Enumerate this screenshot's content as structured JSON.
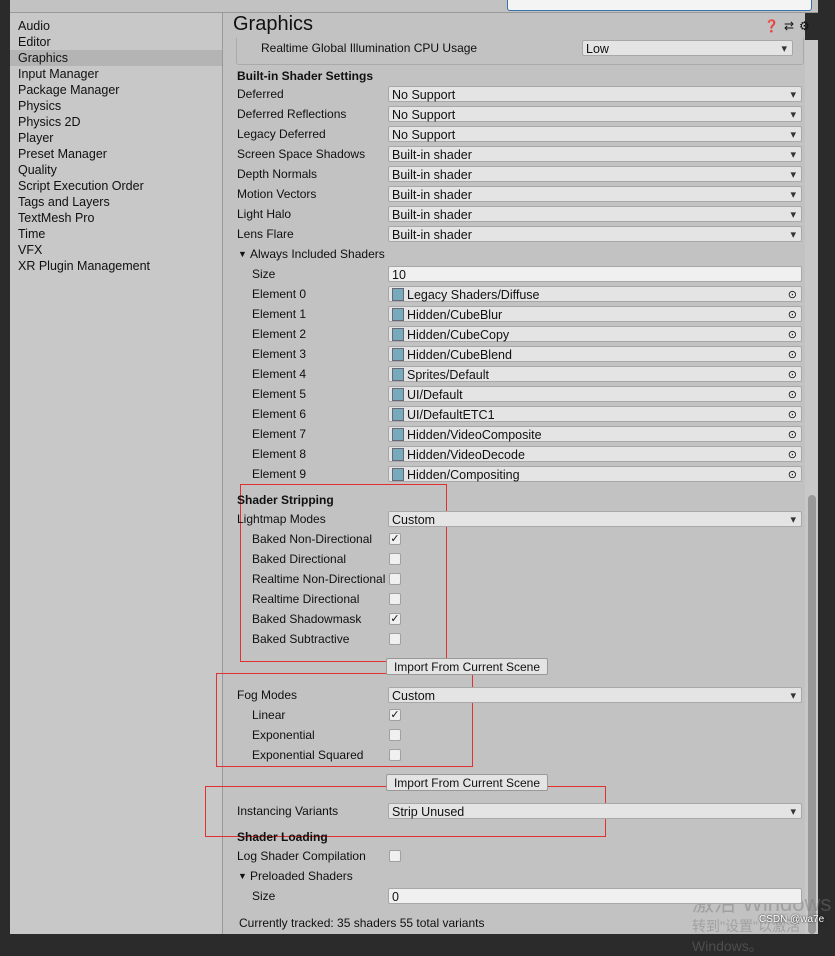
{
  "sidebar": {
    "items": [
      "Audio",
      "Editor",
      "Graphics",
      "Input Manager",
      "Package Manager",
      "Physics",
      "Physics 2D",
      "Player",
      "Preset Manager",
      "Quality",
      "Script Execution Order",
      "Tags and Layers",
      "TextMesh Pro",
      "Time",
      "VFX",
      "XR Plugin Management"
    ],
    "selected": "Graphics"
  },
  "header": {
    "title": "Graphics",
    "icons": [
      "help-icon",
      "preset-icon",
      "gear-icon"
    ]
  },
  "gi": {
    "label": "Realtime Global Illumination CPU Usage",
    "value": "Low"
  },
  "builtin": {
    "heading": "Built-in Shader Settings",
    "rows": [
      {
        "label": "Deferred",
        "value": "No Support"
      },
      {
        "label": "Deferred Reflections",
        "value": "No Support"
      },
      {
        "label": "Legacy Deferred",
        "value": "No Support"
      },
      {
        "label": "Screen Space Shadows",
        "value": "Built-in shader"
      },
      {
        "label": "Depth Normals",
        "value": "Built-in shader"
      },
      {
        "label": "Motion Vectors",
        "value": "Built-in shader"
      },
      {
        "label": "Light Halo",
        "value": "Built-in shader"
      },
      {
        "label": "Lens Flare",
        "value": "Built-in shader"
      }
    ]
  },
  "always": {
    "label": "Always Included Shaders",
    "size_label": "Size",
    "size": "10",
    "elements": [
      {
        "label": "Element 0",
        "value": "Legacy Shaders/Diffuse"
      },
      {
        "label": "Element 1",
        "value": "Hidden/CubeBlur"
      },
      {
        "label": "Element 2",
        "value": "Hidden/CubeCopy"
      },
      {
        "label": "Element 3",
        "value": "Hidden/CubeBlend"
      },
      {
        "label": "Element 4",
        "value": "Sprites/Default"
      },
      {
        "label": "Element 5",
        "value": "UI/Default"
      },
      {
        "label": "Element 6",
        "value": "UI/DefaultETC1"
      },
      {
        "label": "Element 7",
        "value": "Hidden/VideoComposite"
      },
      {
        "label": "Element 8",
        "value": "Hidden/VideoDecode"
      },
      {
        "label": "Element 9",
        "value": "Hidden/Compositing"
      }
    ]
  },
  "stripping": {
    "heading": "Shader Stripping",
    "lightmap_label": "Lightmap Modes",
    "lightmap_value": "Custom",
    "lightmap_options": [
      {
        "label": "Baked Non-Directional",
        "checked": true
      },
      {
        "label": "Baked Directional",
        "checked": false
      },
      {
        "label": "Realtime Non-Directional",
        "checked": false
      },
      {
        "label": "Realtime Directional",
        "checked": false
      },
      {
        "label": "Baked Shadowmask",
        "checked": true
      },
      {
        "label": "Baked Subtractive",
        "checked": false
      }
    ],
    "import_label": "Import From Current Scene",
    "fog_label": "Fog Modes",
    "fog_value": "Custom",
    "fog_options": [
      {
        "label": "Linear",
        "checked": true
      },
      {
        "label": "Exponential",
        "checked": false
      },
      {
        "label": "Exponential Squared",
        "checked": false
      }
    ],
    "import2_label": "Import From Current Scene",
    "instancing_label": "Instancing Variants",
    "instancing_value": "Strip Unused"
  },
  "loading": {
    "heading": "Shader Loading",
    "log_label": "Log Shader Compilation",
    "log_checked": false,
    "preloaded_label": "Preloaded Shaders",
    "size_label": "Size",
    "size": "0",
    "tracked": "Currently tracked: 35 shaders 55 total variants"
  },
  "watermark": {
    "line1": "激活 Windows",
    "line2": "转到\"设置\"以激活 Windows。",
    "credit": "CSDN @wa7e"
  },
  "highlight_color": "#e03030"
}
